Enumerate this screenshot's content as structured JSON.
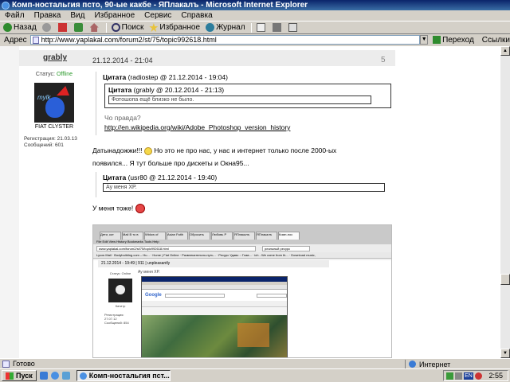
{
  "window": {
    "title": "Комп-ностальгия пcто, 90-ые какбе - ЯПлакалъ - Microsoft Internet Explorer"
  },
  "menu": [
    "Файл",
    "Правка",
    "Вид",
    "Избранное",
    "Сервис",
    "Справка"
  ],
  "toolbar": {
    "back": "Назад",
    "search": "Поиск",
    "favorites": "Избранное",
    "history": "Журнал"
  },
  "address": {
    "label": "Адрес",
    "url": "http://www.yaplakal.com/forum2/st/75/topic992618.html",
    "go": "Переход",
    "links": "Ссылки"
  },
  "post": {
    "author": "grably",
    "date": "21.12.2014 - 21:04",
    "number": "5",
    "status_label": "Статус:",
    "status_value": "Offline",
    "avatar_text": "mylk",
    "user_name": "FIAT CLYSTER",
    "registered": "Регистрация: 21.03.13",
    "messages": "Сообщений: 601",
    "quote1_label": "Цитата",
    "quote1_meta": "(radiostep @ 21.12.2014 - 19:04)",
    "quote2_label": "Цитата",
    "quote2_meta": "(grably @ 20.12.2014 - 21:13)",
    "quote2_text": "Фотошопа ещё близко не было.",
    "question": "Чо правда?",
    "link": "http://en.wikipedia.org/wiki/Adobe_Photoshop_version_history",
    "text_line1": "Датынадожжи!!! ",
    "text_line1b": " Но это не про нас, у нас и интернет только после 2000-ых",
    "text_line2": "появился... Я тут больше про дискеты и Окна95...",
    "quote3_label": "Цитата",
    "quote3_meta": "(usr80 @ 21.12.2014 - 19:40)",
    "quote3_text": "Ау меня XP.",
    "me_too": "У меня тоже! "
  },
  "embedded": {
    "tabs": [
      "Дети, кот",
      "Mail В то в",
      "Widow of",
      "Asian Faith",
      "Обросить",
      "Любовь Р",
      "ЯПлакалъ",
      "ЯПлакалъ",
      "Комп-нос"
    ],
    "menu": "File Edit View History Bookmarks Tools Help",
    "url": "www.yaplakal.com/forum2/st/75/topic992618.html",
    "search": "реальный ресурс",
    "bookmarks": "Lycos Mail · Bodybuilding.com – Hu... · Home | Fiat Online · Развлекательно-путь... · Ресурс Удаво :: Глав... · ich - We come from th... · Download music,",
    "post_strip": "21.12.2014 - 19:49   |  911  |  unpleasantly",
    "quote": "Ау меня XP.",
    "status": "Статус: Online",
    "user": "Катитр",
    "registered": "Регистрация: 27.07.12",
    "messages": "Сообщений: 854",
    "google": "Google"
  },
  "statusbar": {
    "text": "Готово",
    "zone": "Интернет"
  },
  "taskbar": {
    "start": "Пуск",
    "task": "Комп-ностальгия пст...",
    "lang": "EN",
    "time": "2:55"
  }
}
